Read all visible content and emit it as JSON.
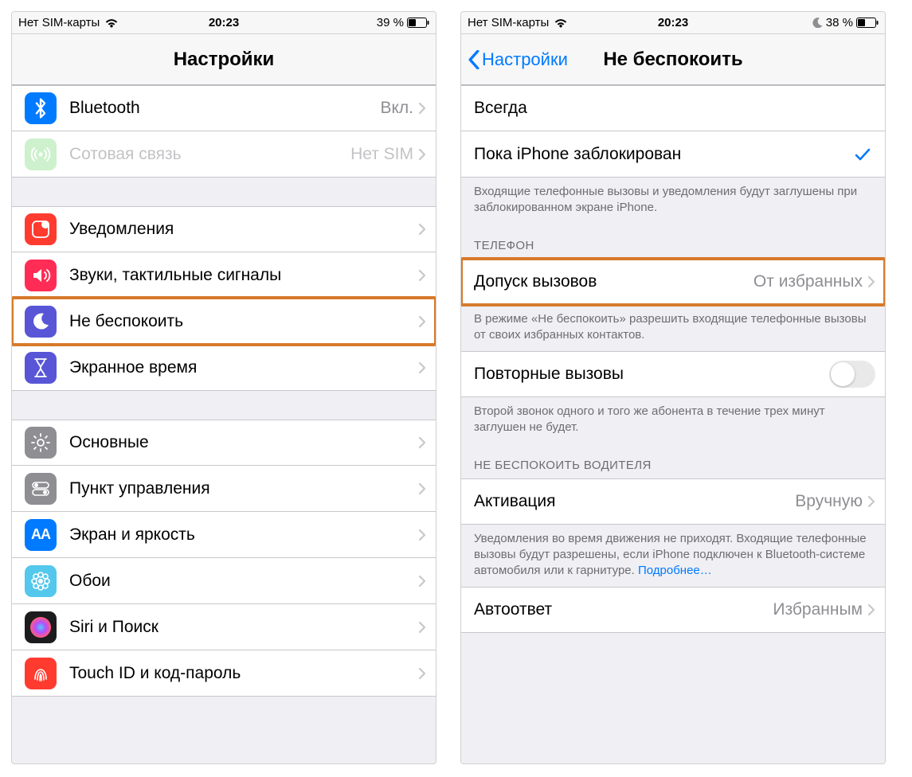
{
  "left": {
    "status": {
      "carrier": "Нет SIM-карты",
      "time": "20:23",
      "battery": "39 %"
    },
    "nav": {
      "title": "Настройки"
    },
    "group1": [
      {
        "icon": "bluetooth",
        "bg": "#007aff",
        "label": "Bluetooth",
        "value": "Вкл."
      },
      {
        "icon": "antenna",
        "bg": "#a5e6a5",
        "dim": true,
        "label": "Сотовая связь",
        "value": "Нет SIM"
      }
    ],
    "group2": [
      {
        "icon": "notifications",
        "bg": "#ff3b30",
        "label": "Уведомления"
      },
      {
        "icon": "sounds",
        "bg": "#ff2d55",
        "label": "Звуки, тактильные сигналы"
      },
      {
        "icon": "moon",
        "bg": "#5856d6",
        "label": "Не беспокоить",
        "highlight": true
      },
      {
        "icon": "hourglass",
        "bg": "#5856d6",
        "label": "Экранное время"
      }
    ],
    "group3": [
      {
        "icon": "gear",
        "bg": "#8e8e93",
        "label": "Основные"
      },
      {
        "icon": "switches",
        "bg": "#8e8e93",
        "label": "Пункт управления"
      },
      {
        "icon": "aa",
        "bg": "#007aff",
        "label": "Экран и яркость"
      },
      {
        "icon": "flower",
        "bg": "#54c7ec",
        "label": "Обои"
      },
      {
        "icon": "siri",
        "bg": "#1c1c1e",
        "label": "Siri и Поиск"
      },
      {
        "icon": "touchid",
        "bg": "#ff3b30",
        "label": "Touch ID и код-пароль"
      }
    ]
  },
  "right": {
    "status": {
      "carrier": "Нет SIM-карты",
      "time": "20:23",
      "battery": "38 %"
    },
    "nav": {
      "back": "Настройки",
      "title": "Не беспокоить"
    },
    "silence": {
      "always": "Всегда",
      "locked": "Пока iPhone заблокирован",
      "footer": "Входящие телефонные вызовы и уведомления будут заглушены при заблокированном экране iPhone."
    },
    "phone": {
      "header": "ТЕЛЕФОН",
      "allow": {
        "label": "Допуск вызовов",
        "value": "От избранных"
      },
      "allow_footer": "В режиме «Не беспокоить» разрешить входящие телефонные вызовы от своих избранных контактов.",
      "repeat": {
        "label": "Повторные вызовы"
      },
      "repeat_footer": "Второй звонок одного и того же абонента в течение трех минут заглушен не будет."
    },
    "driving": {
      "header": "НЕ БЕСПОКОИТЬ ВОДИТЕЛЯ",
      "activate": {
        "label": "Активация",
        "value": "Вручную"
      },
      "activate_footer": "Уведомления во время движения не приходят. Входящие телефонные вызовы будут разрешены, если iPhone подключен к Bluetooth-системе автомобиля или к гарнитуре. ",
      "activate_link": "Подробнее…",
      "autoreply": {
        "label": "Автоответ",
        "value": "Избранным"
      }
    }
  }
}
